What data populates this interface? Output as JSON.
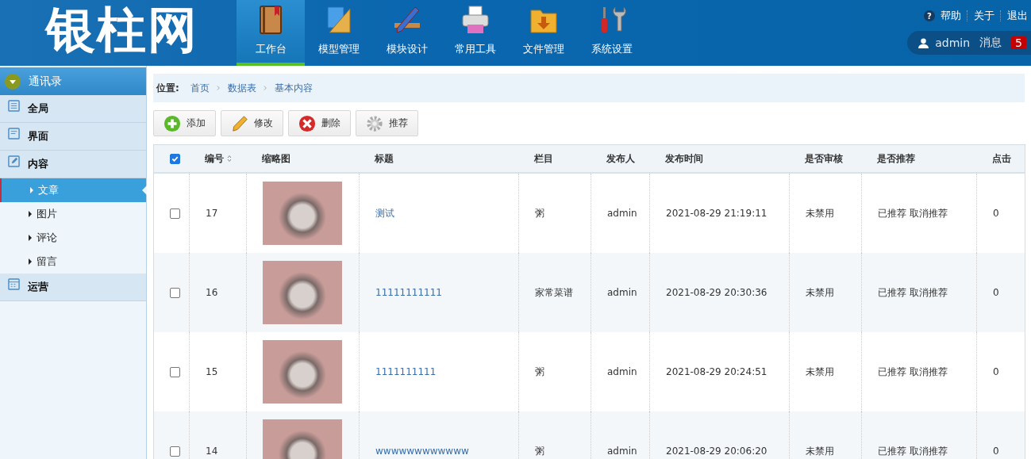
{
  "header": {
    "logo": "银柱网",
    "nav": [
      {
        "label": "工作台",
        "selected": true
      },
      {
        "label": "模型管理",
        "selected": false
      },
      {
        "label": "模块设计",
        "selected": false
      },
      {
        "label": "常用工具",
        "selected": false
      },
      {
        "label": "文件管理",
        "selected": false
      },
      {
        "label": "系统设置",
        "selected": false
      }
    ],
    "help_icon": "?",
    "links": [
      "帮助",
      "关于",
      "退出"
    ],
    "user": "admin",
    "messages_label": "消息",
    "messages_count": "5"
  },
  "sidebar": {
    "title": "通讯录",
    "groups": [
      {
        "label": "全局"
      },
      {
        "label": "界面"
      },
      {
        "label": "内容",
        "children": [
          {
            "label": "文章",
            "selected": true
          },
          {
            "label": "图片",
            "selected": false
          },
          {
            "label": "评论",
            "selected": false
          },
          {
            "label": "留言",
            "selected": false
          }
        ]
      },
      {
        "label": "运营"
      }
    ]
  },
  "breadcrumb": {
    "label": "位置:",
    "items": [
      "首页",
      "数据表",
      "基本内容"
    ]
  },
  "toolbar": [
    {
      "kind": "add",
      "label": "添加"
    },
    {
      "kind": "edit",
      "label": "修改"
    },
    {
      "kind": "delete",
      "label": "删除"
    },
    {
      "kind": "settings",
      "label": "推荐"
    }
  ],
  "table": {
    "select_all_checked": true,
    "columns": [
      "编号",
      "缩略图",
      "标题",
      "栏目",
      "发布人",
      "发布时间",
      "是否审核",
      "是否推荐",
      "点击"
    ],
    "rows": [
      {
        "checked": false,
        "id": "17",
        "title": "测试",
        "category": "粥",
        "author": "admin",
        "time": "2021-08-29 21:19:11",
        "audit": "未禁用",
        "recommend_status": "已推荐",
        "recommend_action": "取消推荐",
        "clicks": "0"
      },
      {
        "checked": false,
        "id": "16",
        "title": "11111111111",
        "category": "家常菜谱",
        "author": "admin",
        "time": "2021-08-29 20:30:36",
        "audit": "未禁用",
        "recommend_status": "已推荐",
        "recommend_action": "取消推荐",
        "clicks": "0"
      },
      {
        "checked": false,
        "id": "15",
        "title": "1111111111",
        "category": "粥",
        "author": "admin",
        "time": "2021-08-29 20:24:51",
        "audit": "未禁用",
        "recommend_status": "已推荐",
        "recommend_action": "取消推荐",
        "clicks": "0"
      },
      {
        "checked": false,
        "id": "14",
        "title": "wwwwwwwwwwww",
        "category": "粥",
        "author": "admin",
        "time": "2021-08-29 20:06:20",
        "audit": "未禁用",
        "recommend_status": "已推荐",
        "recommend_action": "取消推荐",
        "clicks": "0"
      }
    ]
  }
}
